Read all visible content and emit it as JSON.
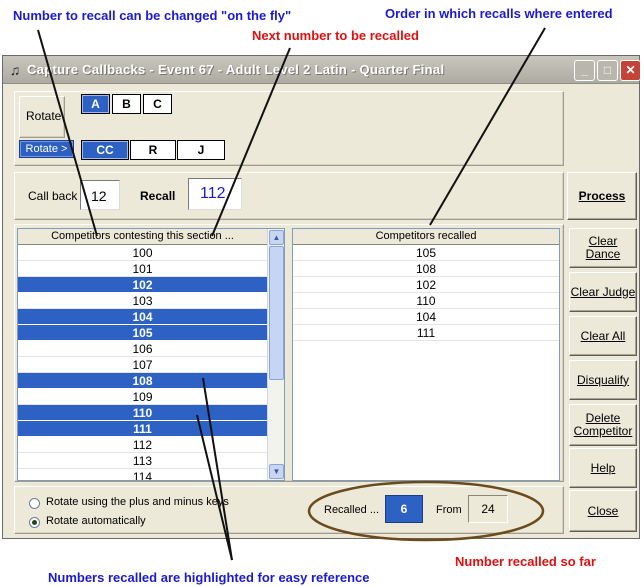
{
  "annotations": {
    "recall_changeable": "Number to recall can be changed \"on the fly\"",
    "recall_order": "Order in which recalls where entered",
    "next_number": "Next number to be recalled",
    "number_recalled": "Number recalled so far",
    "highlighted": "Numbers recalled are highlighted for easy reference"
  },
  "window": {
    "title": "Capture Callbacks - Event 67 - Adult Level 2 Latin - Quarter Final",
    "minimize_glyph": "_",
    "maximize_glyph": "□",
    "close_glyph": "✕"
  },
  "rotate": {
    "label": "Rotate",
    "rotate_button": "Rotate >",
    "groups": [
      "A",
      "B",
      "C"
    ],
    "selected_group": "A",
    "judges": [
      "CC",
      "R",
      "J"
    ],
    "selected_judge": "CC"
  },
  "callback": {
    "label": "Call back",
    "value": "12",
    "recall_label": "Recall",
    "recall_value": "112"
  },
  "competitors": {
    "header": "Competitors contesting this section ...",
    "rows": [
      {
        "num": "100",
        "recalled": false
      },
      {
        "num": "101",
        "recalled": false
      },
      {
        "num": "102",
        "recalled": true
      },
      {
        "num": "103",
        "recalled": false
      },
      {
        "num": "104",
        "recalled": true
      },
      {
        "num": "105",
        "recalled": true
      },
      {
        "num": "106",
        "recalled": false
      },
      {
        "num": "107",
        "recalled": false
      },
      {
        "num": "108",
        "recalled": true
      },
      {
        "num": "109",
        "recalled": false
      },
      {
        "num": "110",
        "recalled": true
      },
      {
        "num": "111",
        "recalled": true
      },
      {
        "num": "112",
        "recalled": false
      },
      {
        "num": "113",
        "recalled": false
      },
      {
        "num": "114",
        "recalled": false
      }
    ]
  },
  "recalled_list": {
    "header": "Competitors recalled",
    "rows": [
      "105",
      "108",
      "102",
      "110",
      "104",
      "111"
    ]
  },
  "buttons": {
    "process": "Process",
    "clear_dance": "Clear Dance",
    "clear_judge": "Clear Judge",
    "clear_all": "Clear All",
    "disqualify": "Disqualify",
    "delete_competitor": "Delete Competitor",
    "help": "Help",
    "close": "Close"
  },
  "rotate_mode": {
    "option_keys": "Rotate using the plus and minus keys",
    "option_auto": "Rotate automatically",
    "selected": "auto"
  },
  "status": {
    "recalled_label": "Recalled ...",
    "recalled_count": "6",
    "from_label": "From",
    "from_count": "24"
  },
  "colors": {
    "highlight": "#2d62c4",
    "annotation_blue": "#1a1ad6",
    "annotation_red": "#e01010"
  }
}
